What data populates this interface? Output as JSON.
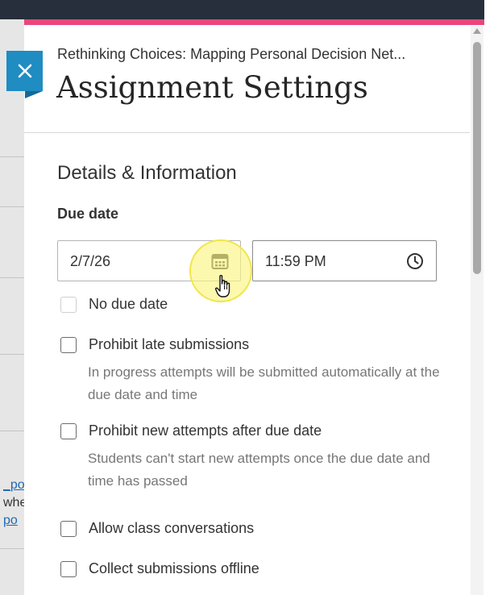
{
  "background": {
    "snippets": [
      {
        "text": "_po",
        "style": "link"
      },
      {
        "text": "whe",
        "style": "text"
      },
      {
        "text": "po",
        "style": "link"
      }
    ]
  },
  "close_button": {
    "icon": "close-icon",
    "label": "×"
  },
  "header": {
    "course_title": "Rethinking Choices: Mapping Personal Decision Net...",
    "title": "Assignment Settings"
  },
  "section": {
    "heading": "Details & Information",
    "due_date_label": "Due date",
    "date_value": "2/7/26",
    "date_icon": "calendar-icon",
    "time_value": "11:59 PM",
    "time_icon": "clock-icon"
  },
  "options": [
    {
      "label": "No due date",
      "checked": false,
      "disabled": true
    },
    {
      "label": "Prohibit late submissions",
      "checked": false,
      "disabled": false,
      "help": "In progress attempts will be submitted automatically at the due date and time"
    },
    {
      "label": "Prohibit new attempts after due date",
      "checked": false,
      "disabled": false,
      "help": "Students can't start new attempts once the due date and time has passed"
    },
    {
      "label": "Allow class conversations",
      "checked": false,
      "disabled": false
    },
    {
      "label": "Collect submissions offline",
      "checked": false,
      "disabled": false
    }
  ],
  "colors": {
    "accent": "#1f8cc2",
    "top_bar": "#262f3b",
    "pink_stripe": "#e8467c",
    "highlight": "#f0e64a"
  }
}
